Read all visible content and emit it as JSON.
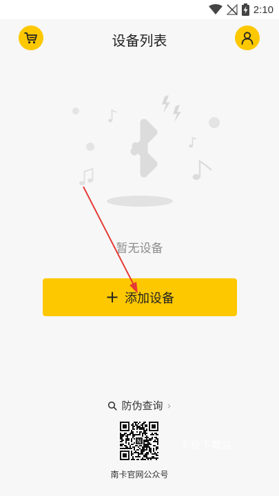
{
  "status_bar": {
    "time": "2:10",
    "icons": [
      "wifi-icon",
      "no-signal-icon",
      "battery-charging-icon"
    ]
  },
  "header": {
    "title": "设备列表",
    "left_icon": "cart-icon",
    "right_icon": "user-icon"
  },
  "empty_state": {
    "message": "暂无设备",
    "illustration_icon": "bluetooth-icon"
  },
  "add_device": {
    "label": "添加设备",
    "icon": "plus-icon"
  },
  "footer": {
    "anti_fake_label": "防伪查询",
    "qr_caption": "南卡官网公众号",
    "watermark": "天极下载站"
  },
  "colors": {
    "accent": "#fdc800",
    "background": "#f7f7f7",
    "annotation_arrow": "#e53935"
  }
}
